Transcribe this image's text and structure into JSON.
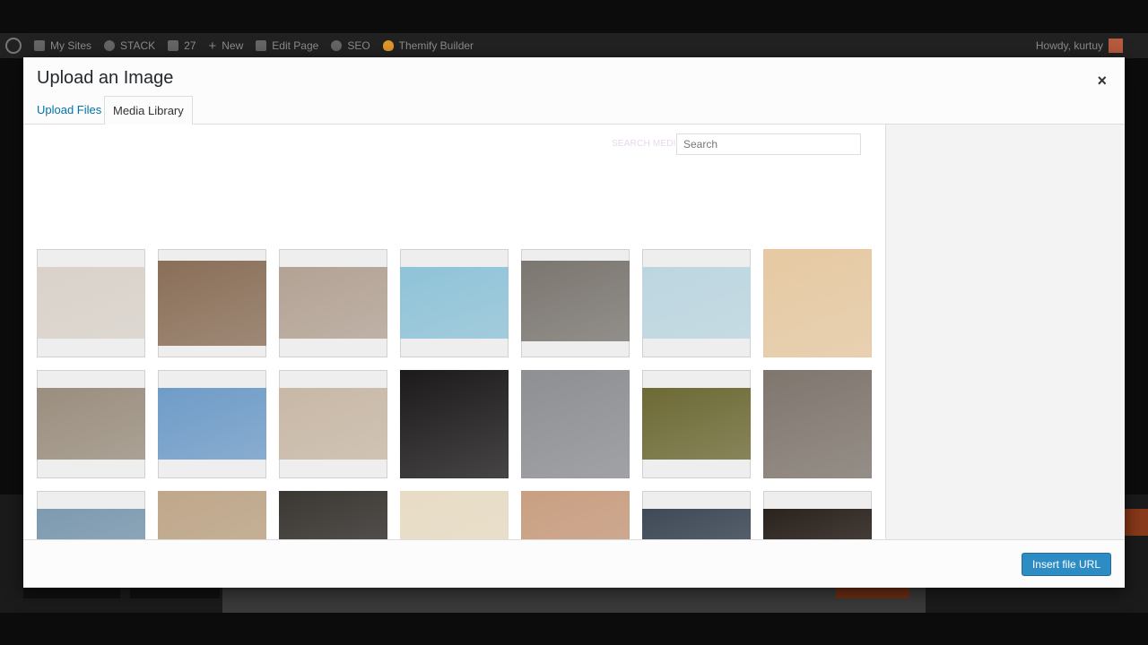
{
  "admin_bar": {
    "my_sites": "My Sites",
    "site_name": "STACK",
    "comments": "27",
    "new": "New",
    "edit_page": "Edit Page",
    "seo": "SEO",
    "builder": "Themify Builder",
    "howdy": "Howdy, kurtuy"
  },
  "modal": {
    "title": "Upload an Image",
    "close": "×",
    "tabs": [
      "Upload Files",
      "Media Library"
    ],
    "active_tab": "Media Library",
    "search_label": "SEARCH MEDIA",
    "search_placeholder": "Search",
    "insert_button": "Insert file URL"
  },
  "colors": {
    "accent": "#2e8cc4",
    "tab_link": "#0073aa",
    "admin_bar": "#222222"
  },
  "thumbnails": [
    [
      {
        "name": "partial-1",
        "color": "#e6e4e2"
      },
      {
        "name": "partial-2",
        "color": "#e6e4e2"
      },
      {
        "name": "partial-3",
        "color": "#e6e4e2"
      },
      {
        "name": "partial-4",
        "color": "#e6e4e2"
      },
      {
        "name": "partial-5",
        "color": "#e6e4e2"
      },
      {
        "name": "partial-6",
        "color": "#3a2a1a"
      },
      {
        "name": "partial-7",
        "color": "#e6e4e2"
      }
    ],
    [
      {
        "name": "woman-in-bed",
        "color": "#d9d2ca"
      },
      {
        "name": "friends-selfie",
        "color": "#8a6f58"
      },
      {
        "name": "girls-group",
        "color": "#b3a294"
      },
      {
        "name": "bike-on-beach",
        "color": "#8fc3d8"
      },
      {
        "name": "photographer-stairs",
        "color": "#7b7670"
      },
      {
        "name": "bicycle-beach",
        "color": "#bcd6e0"
      },
      {
        "name": "model-arms-up",
        "color": "#e6c9a2"
      }
    ],
    [
      {
        "name": "woman-by-wall",
        "color": "#9a8e7e"
      },
      {
        "name": "woman-in-van",
        "color": "#6f9cc8"
      },
      {
        "name": "man-in-suit",
        "color": "#c8b8a6"
      },
      {
        "name": "woman-sunglasses",
        "color": "#1c1a1a"
      },
      {
        "name": "couple-sweaters",
        "color": "#8d8f93"
      },
      {
        "name": "woman-sunset-grass",
        "color": "#6d6a35"
      },
      {
        "name": "blonde-lace-dress",
        "color": "#7f766e"
      }
    ],
    [
      {
        "name": "couple-embrace",
        "color": "#7d9ab0"
      },
      {
        "name": "woman-field",
        "color": "#bfa78a"
      },
      {
        "name": "bearded-man",
        "color": "#3b3834"
      },
      {
        "name": "blonde-portrait",
        "color": "#e8dcc5"
      },
      {
        "name": "woman-bench",
        "color": "#c99f82"
      },
      {
        "name": "man-sitting",
        "color": "#3f4a57"
      },
      {
        "name": "woman-floor",
        "color": "#2a221d"
      }
    ]
  ]
}
